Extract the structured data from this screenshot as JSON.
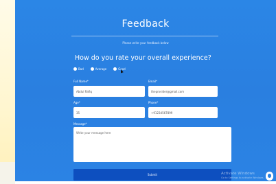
{
  "form": {
    "title": "Feedback",
    "subtitle": "Please write your feedback below",
    "question": "How do you rate your overall experience?",
    "rating_options": [
      "Bad",
      "Average",
      "Good"
    ],
    "fields": {
      "full_name": {
        "label": "Full Name*",
        "value": "Abdul Rafiq"
      },
      "email": {
        "label": "Email*",
        "value": "theprovider@gmail.com"
      },
      "age": {
        "label": "Age*",
        "value": "35"
      },
      "phone": {
        "label": "Phone*",
        "value": "+91234567899"
      },
      "message": {
        "label": "Message*",
        "placeholder": "Write your message here"
      }
    },
    "submit_label": "Submit"
  },
  "overlay": {
    "watermark_title": "Activate Windows",
    "watermark_sub": "Go to Settings to activate Windows."
  }
}
